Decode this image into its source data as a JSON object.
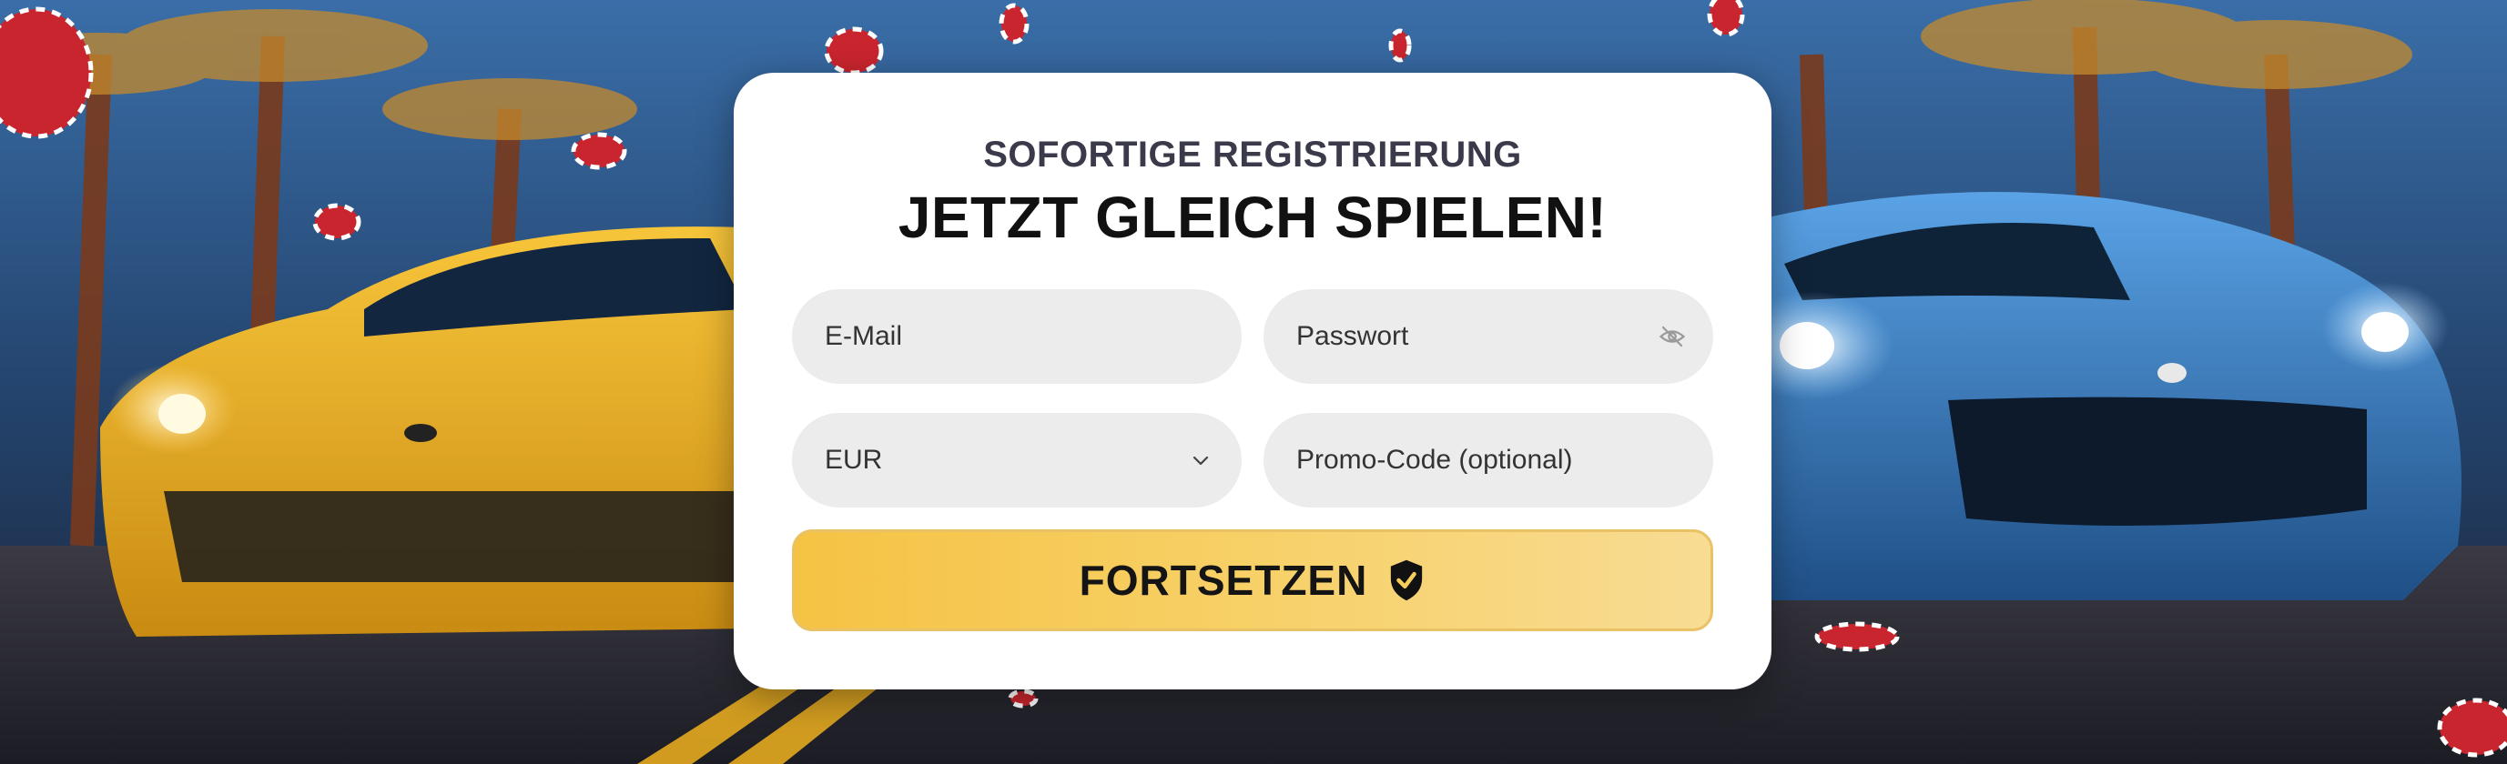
{
  "form": {
    "subtitle": "SOFORTIGE REGISTRIERUNG",
    "title": "JETZT GLEICH SPIELEN!",
    "email_placeholder": "E-Mail",
    "password_placeholder": "Passwort",
    "currency_value": "EUR",
    "promo_placeholder": "Promo-Code (optional)",
    "submit_label": "FORTSETZEN"
  },
  "icons": {
    "password_toggle": "eye-slash-icon",
    "currency_dropdown": "chevron-down-icon",
    "submit_badge": "shield-check-icon"
  },
  "colors": {
    "button_start": "#f5c344",
    "button_end": "#f8dc94",
    "field_bg": "#ececec",
    "card_bg": "#ffffff",
    "title_text": "#111111",
    "subtitle_text": "#3a3a4a"
  }
}
